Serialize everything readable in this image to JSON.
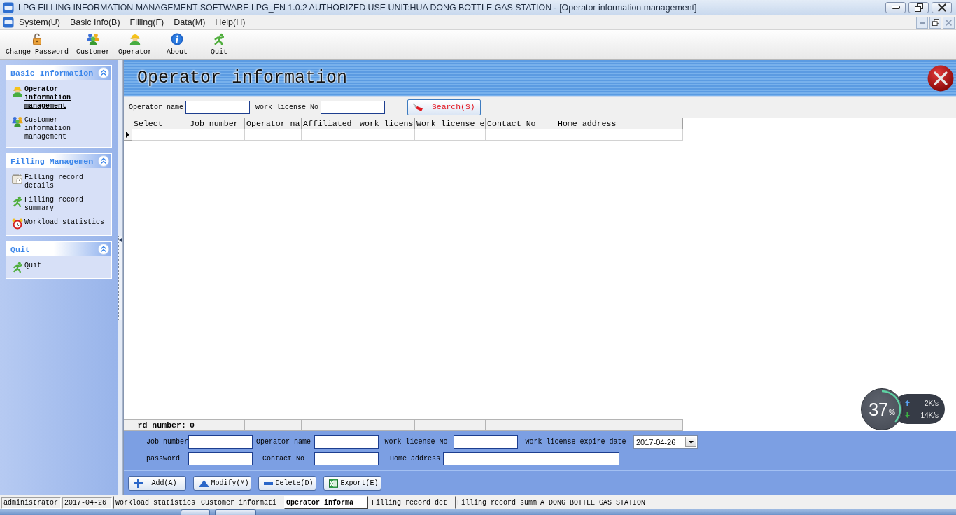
{
  "window": {
    "title": "LPG FILLING INFORMATION MANAGEMENT SOFTWARE LPG_EN 1.0.2 AUTHORIZED USE UNIT:HUA DONG BOTTLE GAS STATION - [Operator information management]"
  },
  "menu": [
    "System(U)",
    "Basic Info(B)",
    "Filling(F)",
    "Data(M)",
    "Help(H)"
  ],
  "toolbar": [
    {
      "label": "Change Password",
      "kind": "password"
    },
    {
      "label": "Customer",
      "kind": "customer"
    },
    {
      "label": "Operator",
      "kind": "operator"
    },
    {
      "label": "About",
      "kind": "about"
    },
    {
      "label": "Quit",
      "kind": "quit"
    }
  ],
  "sidebar": {
    "groups": [
      {
        "title": "Basic Information",
        "expanded": true,
        "items": [
          {
            "label": "Operator information management",
            "kind": "operator",
            "selected": true
          },
          {
            "label": "Customer information management",
            "kind": "customer",
            "selected": false
          }
        ]
      },
      {
        "title": "Filling Managemen",
        "expanded": true,
        "items": [
          {
            "label": "Filling record details",
            "kind": "details",
            "selected": false
          },
          {
            "label": "Filling record summary",
            "kind": "summary",
            "selected": false
          },
          {
            "label": "Workload statistics",
            "kind": "workload",
            "selected": false
          }
        ]
      },
      {
        "title": "Quit",
        "expanded": true,
        "items": [
          {
            "label": "Quit",
            "kind": "quit",
            "selected": false
          }
        ]
      }
    ]
  },
  "page": {
    "title": "Operator information"
  },
  "search": {
    "fields": [
      {
        "label": "Operator name"
      },
      {
        "label": "work license No"
      }
    ],
    "button": "Search(S)"
  },
  "table": {
    "columns": [
      "Select",
      "Job number",
      "Operator na",
      "Affiliated",
      "work licens",
      "Work license e",
      "Contact No",
      "Home address"
    ],
    "rows": [
      {
        "current": true
      }
    ],
    "footer": {
      "label": "rd number:",
      "value": "0"
    }
  },
  "form": {
    "rows": [
      [
        {
          "label": "Job number",
          "kind": "text"
        },
        {
          "label": "Operator name",
          "kind": "text"
        },
        {
          "label": "Work license No",
          "kind": "text"
        },
        {
          "label": "Work license expire date",
          "kind": "date",
          "value": "2017-04-26"
        }
      ],
      [
        {
          "label": "password",
          "kind": "text"
        },
        {
          "label": "Contact No",
          "kind": "text"
        },
        {
          "label": "Home address",
          "kind": "wide"
        }
      ]
    ],
    "buttons": [
      {
        "label": "Add(A)",
        "kind": "add"
      },
      {
        "label": "Modify(M)",
        "kind": "modify"
      },
      {
        "label": "Delete(D)",
        "kind": "delete"
      },
      {
        "label": "Export(E)",
        "kind": "export"
      }
    ]
  },
  "status_bar": {
    "user": "administrator",
    "date": "2017-04-26",
    "tabs": [
      {
        "label": "Workload statistics",
        "selected": false
      },
      {
        "label": "Customer informati",
        "selected": false
      },
      {
        "label": "Operator informa",
        "selected": true
      },
      {
        "label": "Filling record det",
        "selected": false
      },
      {
        "label": "Filling record summ",
        "selected": false
      }
    ],
    "text": "A DONG BOTTLE GAS STATION"
  },
  "widget": {
    "percent": "37",
    "unit": "%",
    "upload": "2K/s",
    "download": "14K/s"
  }
}
